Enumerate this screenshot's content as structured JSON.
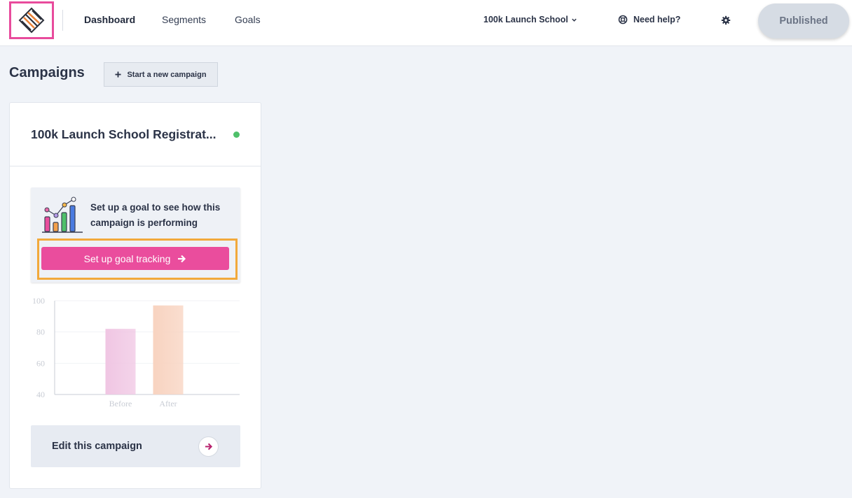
{
  "topbar": {
    "nav": [
      {
        "label": "Dashboard",
        "active": true
      },
      {
        "label": "Segments",
        "active": false
      },
      {
        "label": "Goals",
        "active": false
      }
    ],
    "project": "100k Launch School",
    "help": "Need help?",
    "publish_status": "Published"
  },
  "page": {
    "title": "Campaigns",
    "new_campaign": "Start a new campaign"
  },
  "campaign": {
    "title": "100k Launch School Registrat...",
    "status": "active",
    "goal_prompt": "Set up a goal to see how this campaign is performing",
    "goal_button": "Set up goal tracking",
    "edit_label": "Edit this campaign"
  },
  "colors": {
    "accent": "#ea4d9d",
    "highlight": "#f2a93b",
    "status_active": "#4fc06a",
    "publish_bg": "#d6dce4"
  },
  "icons": {
    "logo": "striped-diamond-logo",
    "help": "lifebuoy-icon",
    "settings": "gear-icon",
    "plus": "plus-icon",
    "arrow": "arrow-right-icon"
  },
  "chart_data": {
    "type": "bar",
    "categories": [
      "Before",
      "After"
    ],
    "values": [
      82,
      97
    ],
    "ylim": [
      40,
      100
    ],
    "yticks": [
      40,
      60,
      80,
      100
    ],
    "grid": true,
    "colors": [
      "#f0c6e3",
      "#f8d3c0"
    ]
  }
}
